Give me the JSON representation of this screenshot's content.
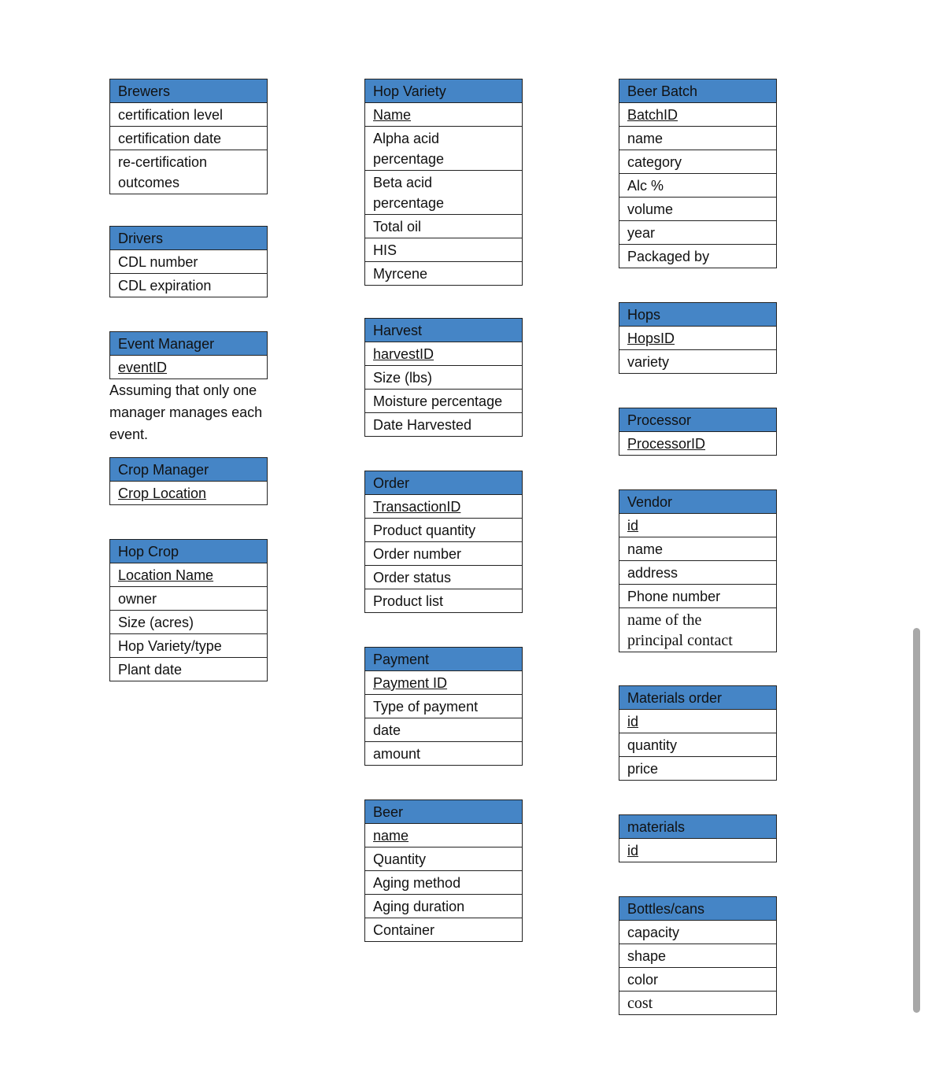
{
  "tables": [
    {
      "title": "Brewers",
      "rows": [
        {
          "text": "certification level"
        },
        {
          "text": "certification date"
        },
        {
          "text": "re-certification\noutcomes"
        }
      ]
    },
    {
      "title": "Drivers",
      "rows": [
        {
          "text": "CDL number"
        },
        {
          "text": "CDL expiration"
        }
      ]
    },
    {
      "title": "Event Manager",
      "rows": [
        {
          "text": "eventID",
          "key": true
        }
      ],
      "note": "Assuming that only one\nmanager manages each\nevent."
    },
    {
      "title": "Crop Manager",
      "rows": [
        {
          "text": "Crop Location",
          "key": true
        }
      ]
    },
    {
      "title": "Hop Crop",
      "rows": [
        {
          "text": "Location Name",
          "key": true
        },
        {
          "text": "owner"
        },
        {
          "text": "Size (acres)"
        },
        {
          "text": "Hop Variety/type"
        },
        {
          "text": "Plant date"
        }
      ]
    },
    {
      "title": "Hop Variety",
      "rows": [
        {
          "text": "Name",
          "key": true
        },
        {
          "text": "Alpha acid\npercentage"
        },
        {
          "text": "Beta acid\npercentage"
        },
        {
          "text": "Total oil"
        },
        {
          "text": "HIS"
        },
        {
          "text": "Myrcene"
        }
      ]
    },
    {
      "title": "Harvest",
      "rows": [
        {
          "text": "harvestID",
          "key": true
        },
        {
          "text": "Size (lbs)"
        },
        {
          "text": "Moisture percentage"
        },
        {
          "text": "Date Harvested"
        }
      ]
    },
    {
      "title": "Order",
      "rows": [
        {
          "text": "TransactionID",
          "key": true
        },
        {
          "text": "Product quantity"
        },
        {
          "text": "Order number"
        },
        {
          "text": "Order status"
        },
        {
          "text": "Product list"
        }
      ]
    },
    {
      "title": "Payment",
      "rows": [
        {
          "text": "Payment ID",
          "key": true
        },
        {
          "text": "Type of payment"
        },
        {
          "text": "date"
        },
        {
          "text": "amount"
        }
      ]
    },
    {
      "title": "Beer",
      "rows": [
        {
          "text": "name",
          "key": true
        },
        {
          "text": "Quantity"
        },
        {
          "text": "Aging method"
        },
        {
          "text": "Aging duration"
        },
        {
          "text": "Container"
        }
      ]
    },
    {
      "title": "Beer Batch",
      "rows": [
        {
          "text": "BatchID",
          "key": true
        },
        {
          "text": "name"
        },
        {
          "text": "category"
        },
        {
          "text": "Alc %"
        },
        {
          "text": "volume"
        },
        {
          "text": "year"
        },
        {
          "text": "Packaged by"
        }
      ]
    },
    {
      "title": "Hops",
      "rows": [
        {
          "text": "HopsID",
          "key": true
        },
        {
          "text": "variety"
        }
      ]
    },
    {
      "title": "Processor",
      "rows": [
        {
          "text": "ProcessorID",
          "key": true
        }
      ]
    },
    {
      "title": "Vendor",
      "rows": [
        {
          "text": "id",
          "key": true
        },
        {
          "text": "name"
        },
        {
          "text": "address"
        },
        {
          "text": "Phone number"
        },
        {
          "text": "name of the\nprincipal contact",
          "serif": true
        }
      ]
    },
    {
      "title": "Materials order",
      "rows": [
        {
          "text": "id",
          "key": true
        },
        {
          "text": "quantity"
        },
        {
          "text": "price"
        }
      ]
    },
    {
      "title": "materials",
      "rows": [
        {
          "text": "id",
          "key": true
        }
      ]
    },
    {
      "title": "Bottles/cans",
      "rows": [
        {
          "text": "capacity"
        },
        {
          "text": "shape"
        },
        {
          "text": "color"
        },
        {
          "text": "cost",
          "serif": true
        }
      ]
    }
  ],
  "colors": {
    "header": "#4585c6",
    "border": "#222222"
  }
}
